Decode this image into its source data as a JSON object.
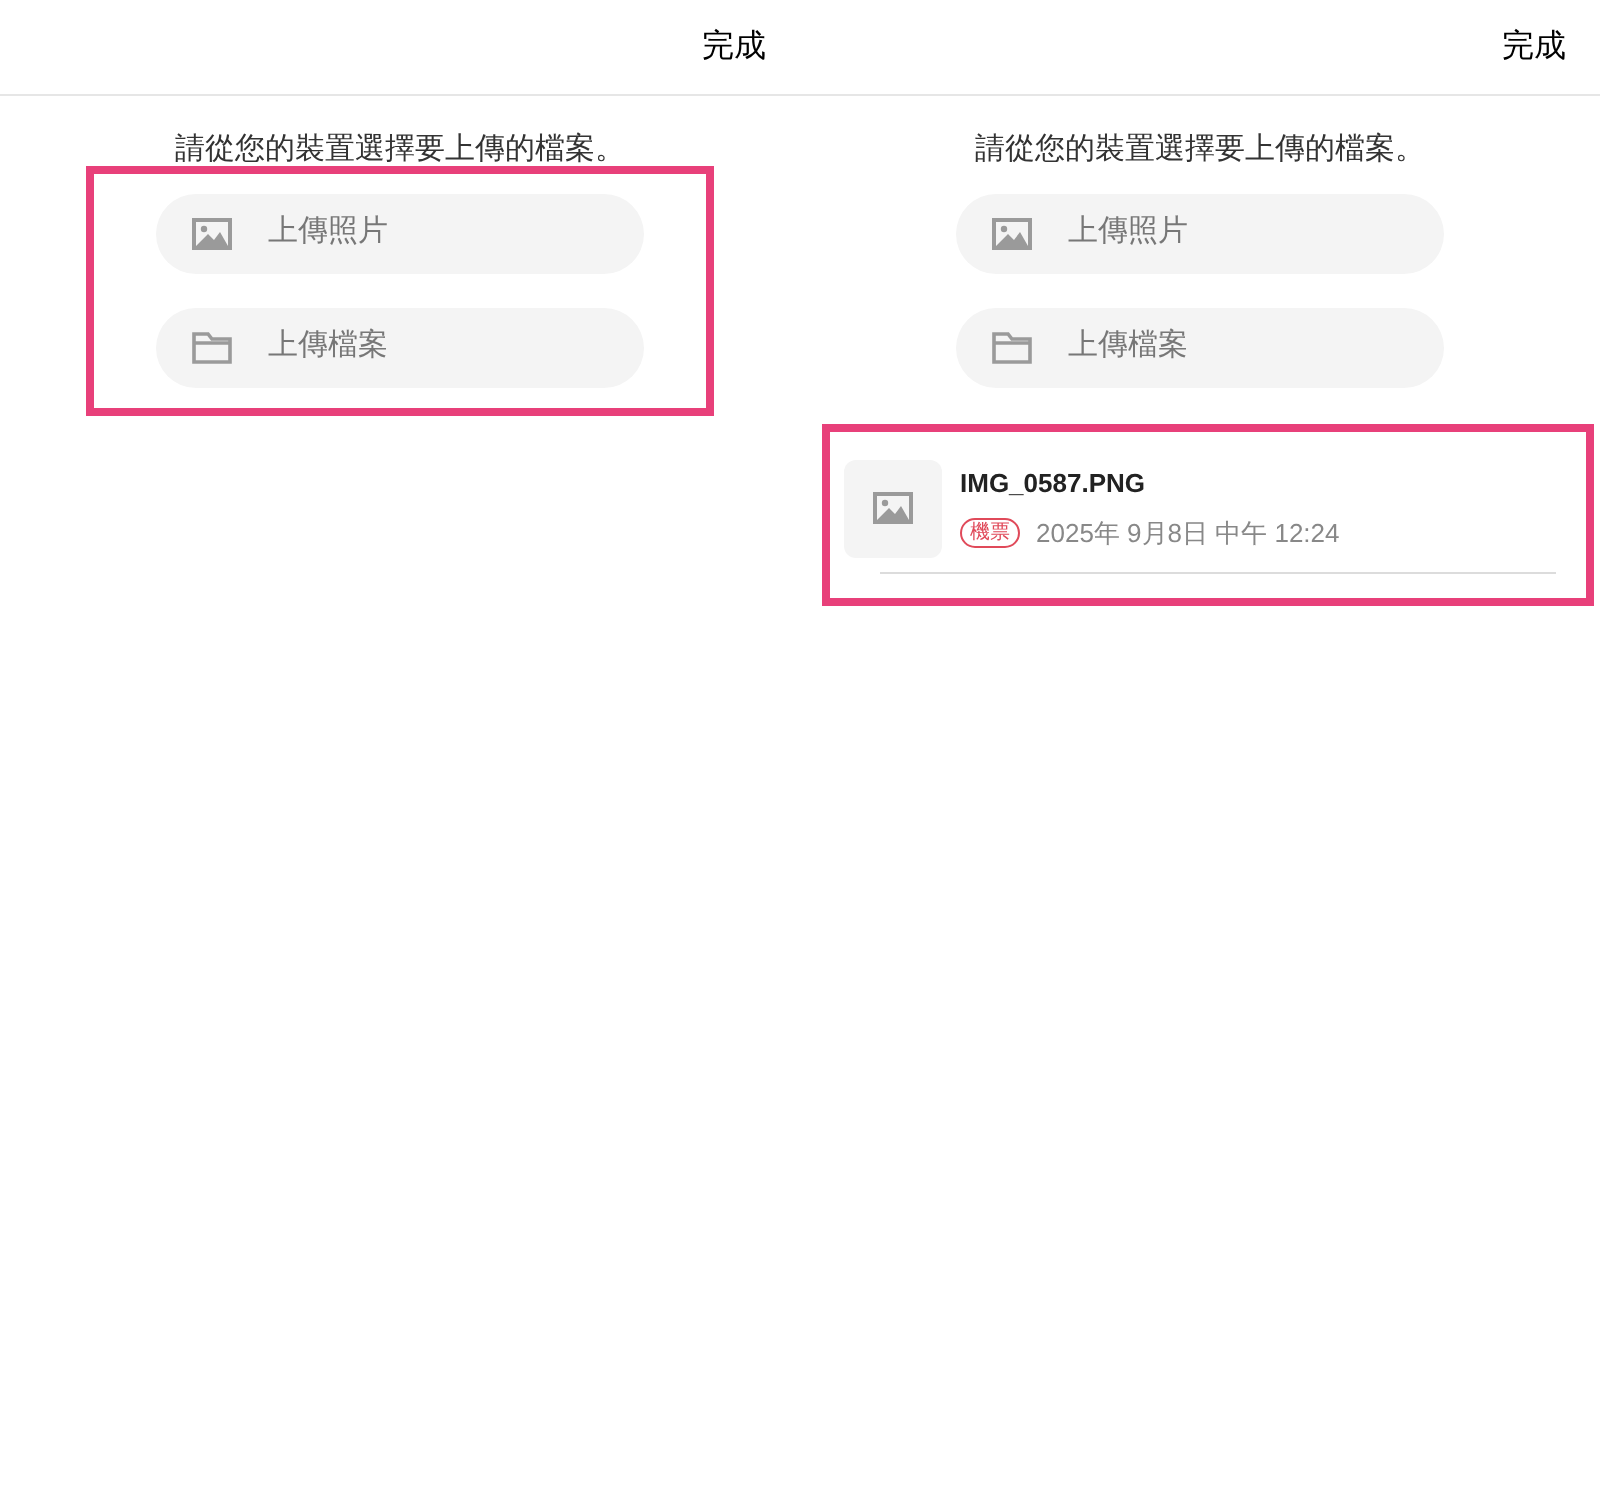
{
  "panels": [
    {
      "done": "完成",
      "prompt": "請從您的裝置選擇要上傳的檔案。",
      "upload_options": {
        "highlighted": true,
        "items": [
          {
            "kind": "photo",
            "label": "上傳照片"
          },
          {
            "kind": "folder",
            "label": "上傳檔案"
          }
        ]
      }
    },
    {
      "done": "完成",
      "prompt": "請從您的裝置選擇要上傳的檔案。",
      "upload_options": {
        "highlighted": false,
        "items": [
          {
            "kind": "photo",
            "label": "上傳照片"
          },
          {
            "kind": "folder",
            "label": "上傳檔案"
          }
        ]
      },
      "file_list": {
        "highlighted": true,
        "items": [
          {
            "name": "IMG_0587.PNG",
            "tag": "機票",
            "date": "2025年 9月8日 中午 12:24"
          }
        ]
      }
    }
  ]
}
